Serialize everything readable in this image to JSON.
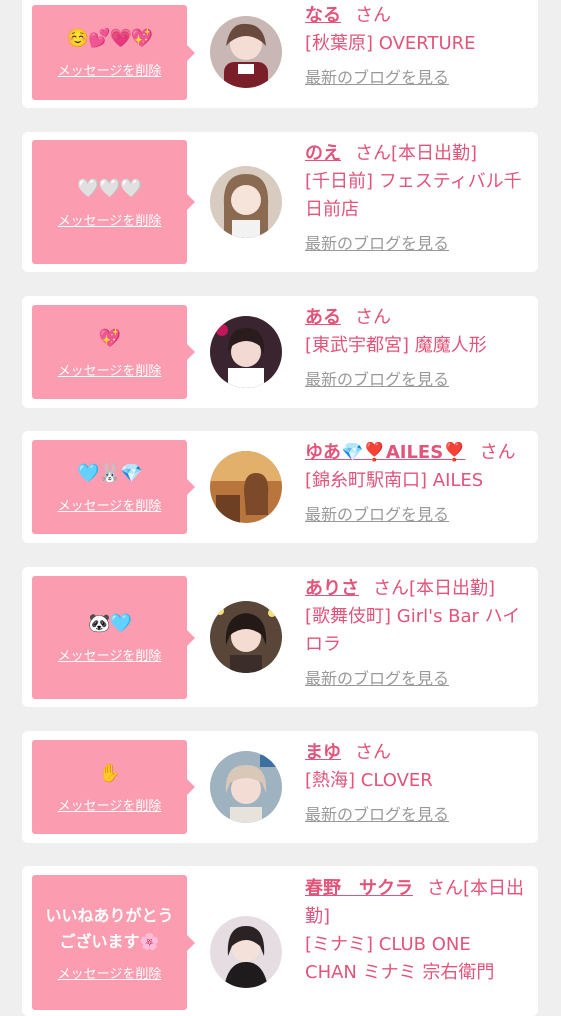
{
  "delete_label": "メッセージを削除",
  "san_label": "さん",
  "blog_label": "最新のブログを見る",
  "cards": [
    {
      "message": "☺️💕💗💖",
      "message_is_text": false,
      "name": "なる",
      "tag": "",
      "shop": "[秋葉原] OVERTURE"
    },
    {
      "message": "🤍🤍🤍",
      "message_is_text": false,
      "name": "のえ",
      "tag": "[本日出勤]",
      "shop": "[千日前] フェスティバル千日前店"
    },
    {
      "message": "💖",
      "message_is_text": false,
      "name": "ある",
      "tag": "",
      "shop": "[東武宇都宮] 魔魔人形"
    },
    {
      "message": "🩵🐰💎",
      "message_is_text": false,
      "name": "ゆあ💎❣️AILES❣️",
      "tag": "",
      "shop": "[錦糸町駅南口] AILES"
    },
    {
      "message": "🐼🩵",
      "message_is_text": false,
      "name": "ありさ",
      "tag": "[本日出勤]",
      "shop": "[歌舞伎町] Girl's Bar ハイロラ"
    },
    {
      "message": "✋",
      "message_is_text": false,
      "name": "まゆ",
      "tag": "",
      "shop": "[熱海] CLOVER"
    },
    {
      "message": "いいねありがとうございます🌸",
      "message_is_text": true,
      "name": "春野　サクラ",
      "tag": "[本日出勤]",
      "shop": "[ミナミ] CLUB ONE CHAN ミナミ 宗右衛門"
    }
  ],
  "colors": {
    "bubble": "#fb9cb0",
    "name": "#e2547a",
    "blog_link": "#999999",
    "background": "#efefef"
  }
}
